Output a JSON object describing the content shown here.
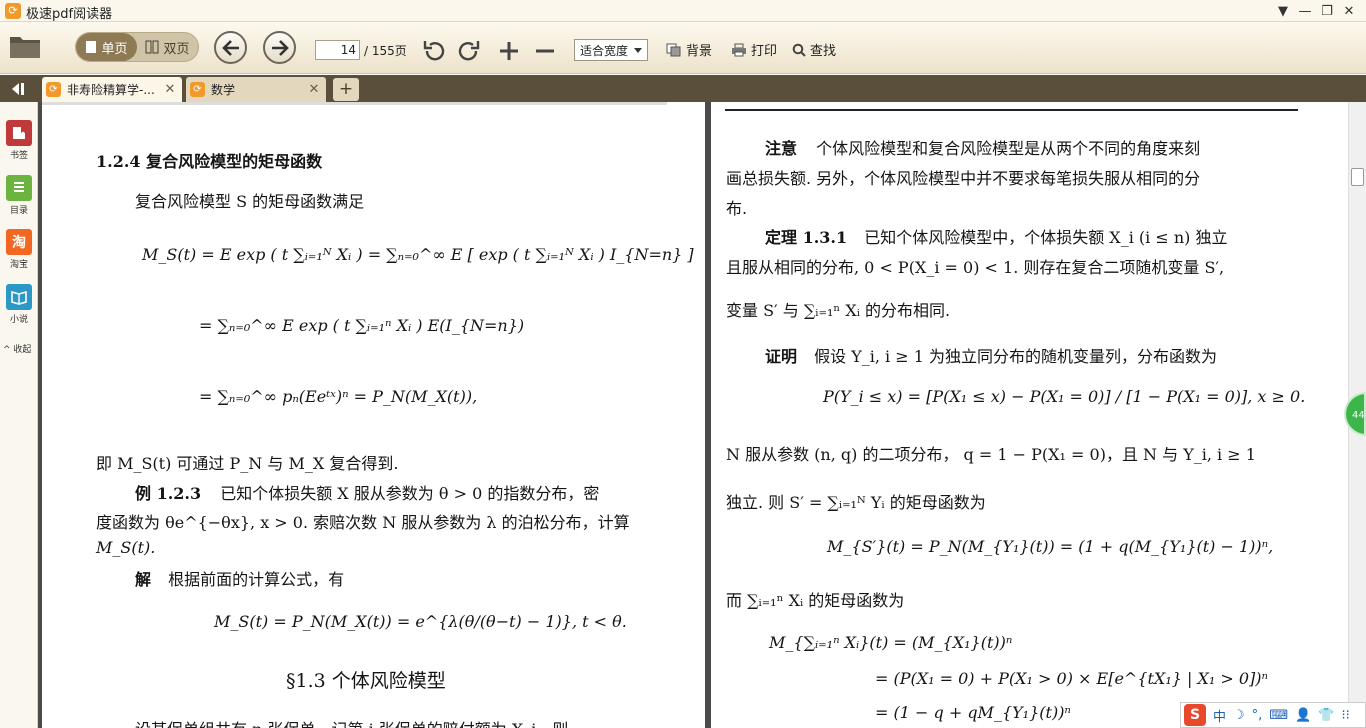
{
  "app": {
    "title": "极速pdf阅读器"
  },
  "window_controls": {
    "menu": "▼",
    "minimize": "—",
    "restore": "❐",
    "close": "✕"
  },
  "toolbar": {
    "single_page": "单页",
    "double_page": "双页",
    "page_current": "14",
    "page_total": "/ 155页",
    "zoom": "适合宽度",
    "background": "背景",
    "print": "打印",
    "search": "查找"
  },
  "tabs": [
    {
      "label": "非寿险精算学-...",
      "close": "✕",
      "active": true
    },
    {
      "label": "数学",
      "close": "✕",
      "active": false
    }
  ],
  "tab_add": "+",
  "sidebar": {
    "items": [
      {
        "label": "书签",
        "icon": "bookmark-icon",
        "color": "#c0393b"
      },
      {
        "label": "目录",
        "icon": "toc-icon",
        "color": "#6db33f"
      },
      {
        "label": "淘宝",
        "icon": "taobao-icon",
        "color": "#f26722",
        "glyph": "淘"
      },
      {
        "label": "小说",
        "icon": "novel-icon",
        "color": "#2b98c5"
      }
    ],
    "collapse": "收起"
  },
  "left_page": {
    "section_title": "1.2.4  复合风险模型的矩母函数",
    "intro": "复合风险模型 S 的矩母函数满足",
    "eq1": "M_S(t) = E exp ( t ∑ᵢ₌₁ᴺ Xᵢ ) = ∑ₙ₌₀^∞ E [ exp ( t ∑ᵢ₌₁ᴺ Xᵢ ) I_{N=n} ]",
    "eq2": "= ∑ₙ₌₀^∞ E exp ( t ∑ᵢ₌₁ⁿ Xᵢ ) E(I_{N=n})",
    "eq3": "= ∑ₙ₌₀^∞ pₙ(Eeᵗˣ)ⁿ = P_N(M_X(t)),",
    "line_a": "即 M_S(t) 可通过 P_N 与 M_X 复合得到.",
    "example_label": "例 1.2.3",
    "example_text1": "已知个体损失额 X 服从参数为 θ > 0 的指数分布，密",
    "example_text2": "度函数为 θe^{−θx}, x > 0. 索赔次数 N 服从参数为 λ 的泊松分布，计算",
    "example_text3": "M_S(t).",
    "solution_label": "解",
    "solution_text": "根据前面的计算公式，有",
    "eq4": "M_S(t) = P_N(M_X(t)) = e^{λ(θ/(θ−t) − 1)},    t < θ.",
    "section_heading": "§1.3   个体风险模型",
    "bottom_partial": "设某保单组共有 n 张保单，记第 i 张保单的赔付额为 X_i，则"
  },
  "right_page": {
    "note_label": "注意",
    "note1": "个体风险模型和复合风险模型是从两个不同的角度来刻",
    "note2": "画总损失额. 另外，个体风险模型中并不要求每笔损失服从相同的分",
    "note3": "布.",
    "theorem_label": "定理 1.3.1",
    "th1": "已知个体风险模型中，个体损失额 X_i (i ≤ n) 独立",
    "th2": "且服从相同的分布, 0 < P(X_i = 0) < 1. 则存在复合二项随机变量 S′,",
    "th3": "变量 S′ 与 ∑ᵢ₌₁ⁿ Xᵢ 的分布相同.",
    "proof_label": "证明",
    "pr1": "假设 Y_i, i ≥ 1 为独立同分布的随机变量列，分布函数为",
    "eq_p": "P(Y_i ≤ x) = [P(X₁ ≤ x) − P(X₁ = 0)] / [1 − P(X₁ = 0)],   x ≥ 0.",
    "pr2": "N 服从参数 (n, q) 的二项分布，  q = 1 − P(X₁ = 0)，且 N 与 Y_i, i ≥ 1",
    "pr3": "独立. 则 S′ = ∑ᵢ₌₁ᴺ Yᵢ 的矩母函数为",
    "eq_m": "M_{S′}(t) = P_N(M_{Y₁}(t)) = (1 + q(M_{Y₁}(t) − 1))ⁿ,",
    "pr4": "而 ∑ᵢ₌₁ⁿ Xᵢ 的矩母函数为",
    "eq_r1": "M_{∑ᵢ₌₁ⁿ Xᵢ}(t) = (M_{X₁}(t))ⁿ",
    "eq_r2": "= (P(X₁ = 0) + P(X₁ > 0) × E[e^{tX₁} | X₁ > 0])ⁿ",
    "eq_r3": "= (1 − q + qM_{Y₁}(t))ⁿ"
  },
  "badge": "44",
  "ime": {
    "logo": "S",
    "lang": "中",
    "items": [
      "☽",
      "°,",
      "⌨",
      "👤",
      "👕",
      "⁝⁝"
    ]
  }
}
